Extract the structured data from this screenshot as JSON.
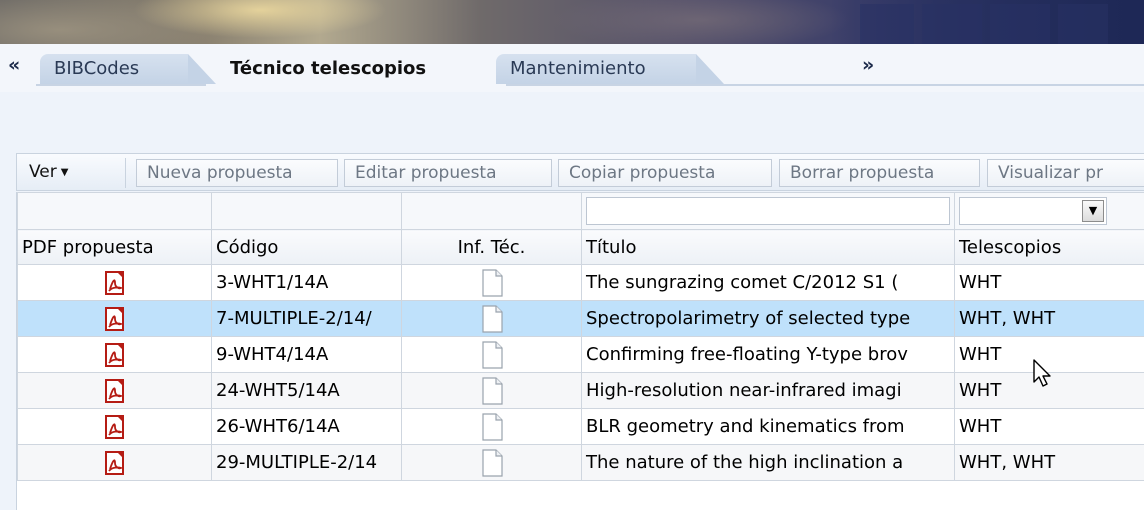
{
  "tabs": {
    "prev_arrow": "«",
    "next_arrow": "»",
    "items": [
      {
        "label": "BIBCodes"
      },
      {
        "label": "Técnico telescopios"
      },
      {
        "label": "Mantenimiento"
      }
    ]
  },
  "toolbar": {
    "ver_label": "Ver",
    "buttons": [
      {
        "label": "Nueva propuesta"
      },
      {
        "label": "Editar propuesta"
      },
      {
        "label": "Copiar propuesta"
      },
      {
        "label": "Borrar propuesta"
      },
      {
        "label": "Visualizar pr"
      }
    ]
  },
  "grid": {
    "columns": [
      "PDF propuesta",
      "Código",
      "Inf. Téc.",
      "Título",
      "Telescopios"
    ],
    "rows": [
      {
        "codigo": "3-WHT1/14A",
        "titulo": "The sungrazing comet C/2012 S1 (",
        "telescopios": "WHT"
      },
      {
        "codigo": "7-MULTIPLE-2/14/",
        "titulo": "Spectropolarimetry of selected type",
        "telescopios": "WHT, WHT"
      },
      {
        "codigo": "9-WHT4/14A",
        "titulo": "Confirming free-floating Y-type brov",
        "telescopios": "WHT"
      },
      {
        "codigo": "24-WHT5/14A",
        "titulo": "High-resolution near-infrared imagi",
        "telescopios": "WHT"
      },
      {
        "codigo": "26-WHT6/14A",
        "titulo": "BLR geometry and kinematics from",
        "telescopios": "WHT"
      },
      {
        "codigo": "29-MULTIPLE-2/14",
        "titulo": "The nature of the high inclination a",
        "telescopios": "WHT, WHT"
      }
    ]
  },
  "colors": {
    "selected_row": "#bfe1fb",
    "pdf_red": "#c8231b"
  }
}
